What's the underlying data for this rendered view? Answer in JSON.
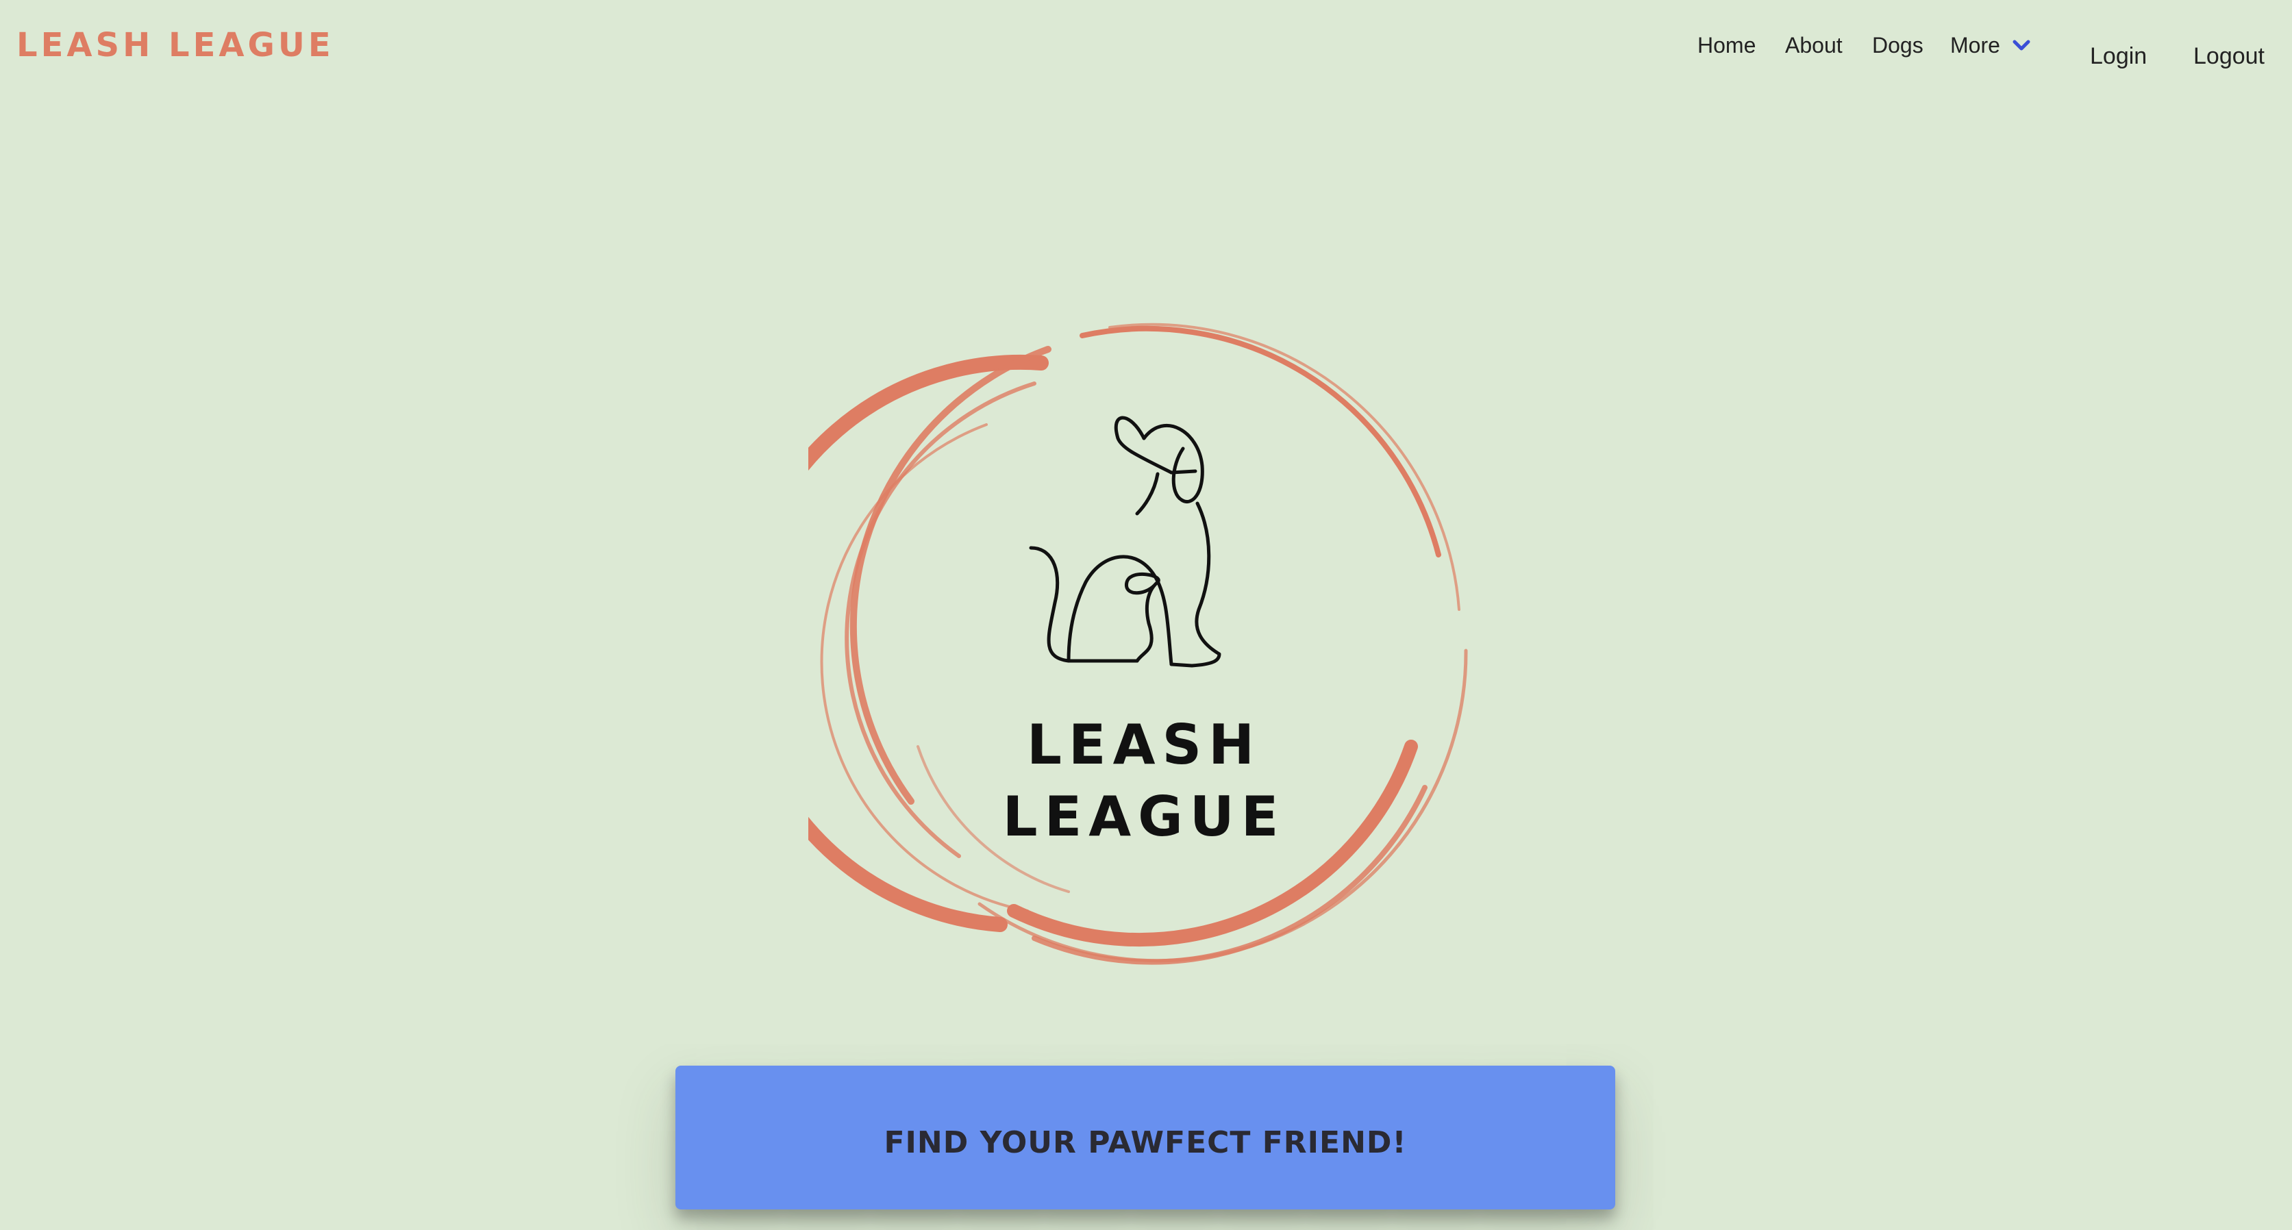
{
  "brand": {
    "name": "LEASH LEAGUE"
  },
  "nav": {
    "home": "Home",
    "about": "About",
    "dogs": "Dogs",
    "more": "More",
    "login": "Login",
    "logout": "Logout"
  },
  "hero": {
    "logo_line1": "LEASH",
    "logo_line2": "LEAGUE",
    "cta_label": "FIND YOUR PAWFECT FRIEND!"
  },
  "colors": {
    "background": "#dce9d4",
    "brand": "#de7d63",
    "cta": "#6890ef",
    "chevron": "#3b4fd6"
  },
  "icons": {
    "more_chevron": "chevron-down-icon",
    "logo_circle": "brush-circle-icon",
    "dog_outline": "dog-outline-icon"
  }
}
